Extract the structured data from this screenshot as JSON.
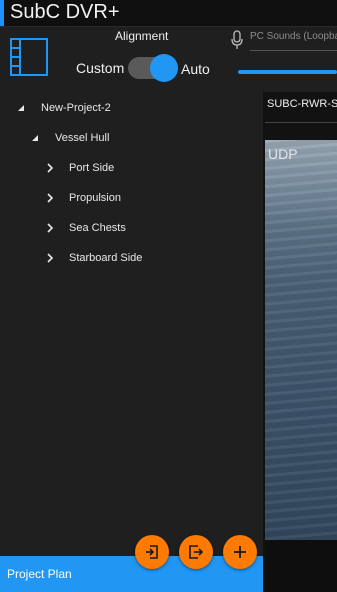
{
  "app": {
    "title": "SubC DVR+"
  },
  "toolbar": {
    "alignment_label": "Alignment",
    "custom_label": "Custom",
    "auto_label": "Auto",
    "alignment_mode": "Auto",
    "audio_source_placeholder": "PC Sounds (Loopbac"
  },
  "tree": {
    "items": [
      {
        "label": "New-Project-2",
        "expanded": true
      },
      {
        "label": "Vessel Hull",
        "expanded": true
      },
      {
        "label": "Port Side",
        "expanded": false
      },
      {
        "label": "Propulsion",
        "expanded": false
      },
      {
        "label": "Sea Chests",
        "expanded": false
      },
      {
        "label": "Starboard Side",
        "expanded": false
      }
    ]
  },
  "video": {
    "camera_name": "SUBC-RWR-SI",
    "overlay_text": "UDP"
  },
  "footer": {
    "project_plan_label": "Project Plan",
    "buttons": [
      "import-icon",
      "export-icon",
      "add-icon"
    ]
  },
  "colors": {
    "accent": "#2196f3",
    "fab": "#ff7a00",
    "background": "#1f1f1f",
    "titlebar": "#0f0f0f"
  }
}
